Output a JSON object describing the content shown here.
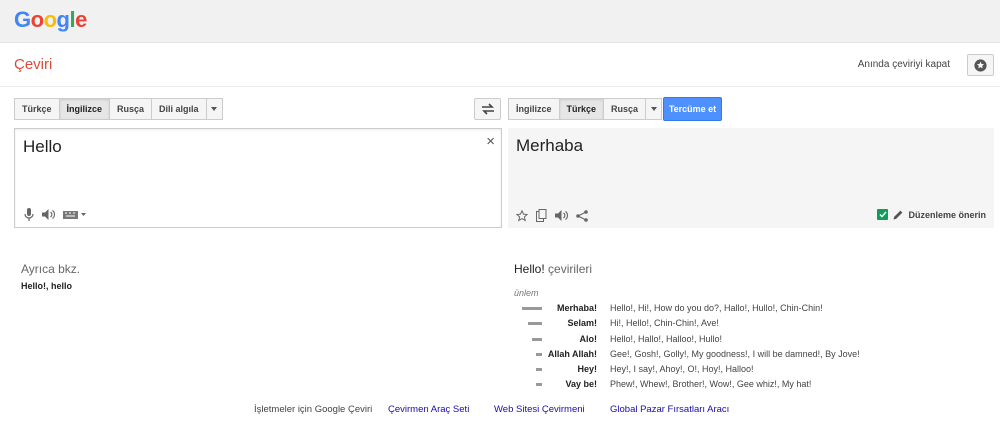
{
  "header": {
    "logo_letters": [
      {
        "char": "G",
        "color": "#4285f4"
      },
      {
        "char": "o",
        "color": "#ea4335"
      },
      {
        "char": "o",
        "color": "#fbbc05"
      },
      {
        "char": "g",
        "color": "#4285f4"
      },
      {
        "char": "l",
        "color": "#34a853"
      },
      {
        "char": "e",
        "color": "#ea4335"
      }
    ]
  },
  "app": {
    "title": "Çeviri",
    "instant_off": "Anında çeviriyi kapat",
    "settings_icon": "star-circle-icon"
  },
  "source_langs": {
    "items": [
      "Türkçe",
      "İngilizce",
      "Rusça",
      "Dili algıla"
    ],
    "active_index": 1
  },
  "target_langs": {
    "items": [
      "İngilizce",
      "Türkçe",
      "Rusça"
    ],
    "active_index": 1
  },
  "translate_button": "Tercüme et",
  "source": {
    "text": "Hello",
    "clear": "×"
  },
  "target": {
    "text": "Merhaba",
    "suggest_edit": "Düzenleme önerin"
  },
  "see_also": {
    "title": "Ayrıca bkz.",
    "words": "Hello!, hello"
  },
  "translations": {
    "title_word": "Hello!",
    "title_suffix": " çevirileri",
    "pos": "ünlem",
    "rows": [
      {
        "word": "Merhaba!",
        "back": "Hello!, Hi!, How do you do?, Hallo!, Hullo!, Chin-Chin!",
        "freq": 1.0
      },
      {
        "word": "Selam!",
        "back": "Hi!, Hello!, Chin-Chin!, Ave!",
        "freq": 0.7
      },
      {
        "word": "Alo!",
        "back": "Hello!, Hallo!, Halloo!, Hullo!",
        "freq": 0.5
      },
      {
        "word": "Allah Allah!",
        "back": "Gee!, Gosh!, Golly!, My goodness!, I will be damned!, By Jove!",
        "freq": 0.3
      },
      {
        "word": "Hey!",
        "back": "Hey!, I say!, Ahoy!, O!, Hoy!, Halloo!",
        "freq": 0.3
      },
      {
        "word": "Vay be!",
        "back": "Phew!, Whew!, Brother!, Wow!, Gee whiz!, My hat!",
        "freq": 0.3
      }
    ]
  },
  "footer": {
    "business": "İşletmeler için Google Çeviri",
    "toolkit": "Çevirmen Araç Seti",
    "website": "Web Sitesi Çevirmeni",
    "market": "Global Pazar Fırsatları Aracı"
  }
}
